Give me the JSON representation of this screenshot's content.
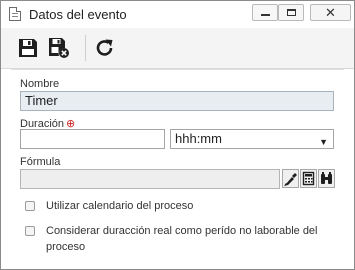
{
  "window": {
    "title": "Datos del evento",
    "controls": {
      "minimize": "minimize",
      "maximize": "maximize",
      "close": "✕"
    }
  },
  "toolbar": {
    "buttons": [
      {
        "name": "save",
        "icon": "floppy-disk-icon"
      },
      {
        "name": "save-and-close",
        "icon": "floppy-disk-close-icon"
      },
      {
        "name": "refresh",
        "icon": "refresh-icon"
      }
    ]
  },
  "form": {
    "name_label": "Nombre",
    "name_value": "Timer",
    "duration_label": "Duración",
    "duration_value": "",
    "duration_unit": "hhh:mm",
    "formula_label": "Fórmula",
    "formula_value": "",
    "formula_buttons": [
      {
        "name": "formula-edit-button",
        "icon": "brush-icon"
      },
      {
        "name": "formula-calculator-button",
        "icon": "calculator-icon"
      },
      {
        "name": "formula-search-button",
        "icon": "binoculars-icon"
      }
    ],
    "checkboxes": [
      {
        "label": "Utilizar calendario del proceso",
        "checked": false
      },
      {
        "label": "Considerar duracción real como perído no laborable del proceso",
        "checked": false
      }
    ]
  },
  "colors": {
    "required": "#cc2222",
    "readonly_field": "#e8edf2",
    "icon_dark": "#1f1f1f"
  }
}
